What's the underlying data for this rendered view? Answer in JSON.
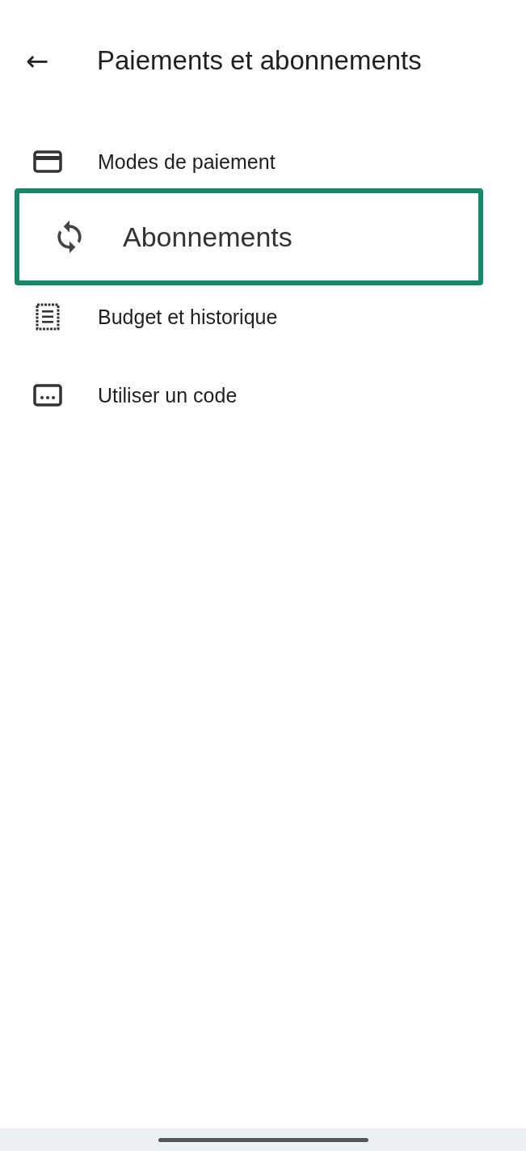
{
  "header": {
    "back": "←",
    "title": "Paiements et abonnements"
  },
  "items": [
    {
      "kind": "card",
      "label": "Modes de paiement",
      "highlighted": false
    },
    {
      "kind": "sync",
      "label": "Abonnements",
      "highlighted": true
    },
    {
      "kind": "receipt",
      "label": "Budget et historique",
      "highlighted": false
    },
    {
      "kind": "code",
      "label": "Utiliser un code",
      "highlighted": false
    }
  ]
}
